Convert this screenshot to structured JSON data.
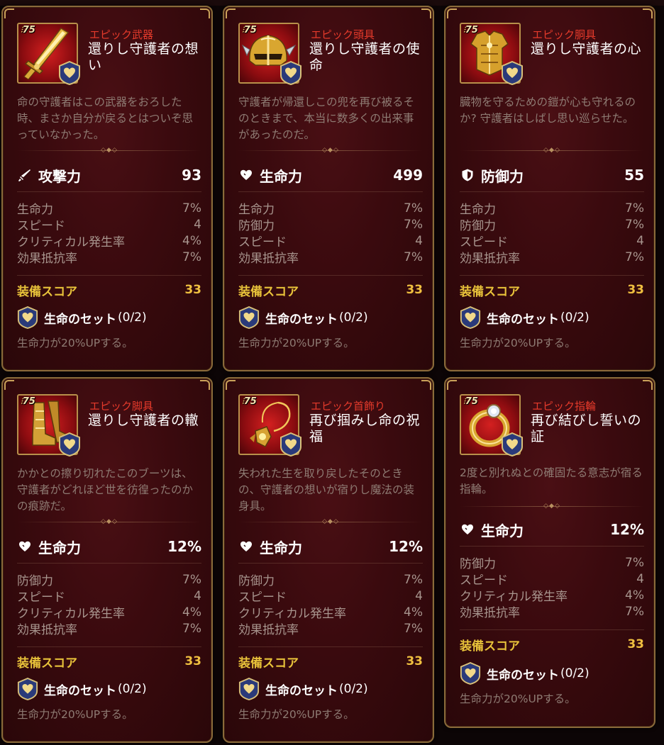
{
  "colors": {
    "category": "#e53a2b",
    "score": "#e8c23a",
    "set_badge_fill": "#2a3a7a",
    "heart": "#e8c872"
  },
  "cards": [
    {
      "level": "75",
      "category": "エピック武器",
      "name": "還りし守護者の想い",
      "description": "命の守護者はこの武器をおろした時、まさか自分が戻るとはついぞ思っていなかった。",
      "main_stat": {
        "icon": "sword-icon",
        "label": "攻撃力",
        "value": "93"
      },
      "substats": [
        {
          "label": "生命力",
          "value": "7%"
        },
        {
          "label": "スピード",
          "value": "4"
        },
        {
          "label": "クリティカル発生率",
          "value": "4%"
        },
        {
          "label": "効果抵抗率",
          "value": "7%"
        }
      ],
      "score_label": "装備スコア",
      "score_value": "33",
      "set_name": "生命のセット",
      "set_count": "(0/2)",
      "set_effect": "生命力が20%UPする。",
      "item_icon": "weapon-icon"
    },
    {
      "level": "75",
      "category": "エピック頭具",
      "name": "還りし守護者の使命",
      "description": "守護者が帰還しこの兜を再び被るそのときまで、本当に数多くの出来事があったのだ。",
      "main_stat": {
        "icon": "heart-icon",
        "label": "生命力",
        "value": "499"
      },
      "substats": [
        {
          "label": "生命力",
          "value": "7%"
        },
        {
          "label": "防御力",
          "value": "7%"
        },
        {
          "label": "スピード",
          "value": "4"
        },
        {
          "label": "効果抵抗率",
          "value": "7%"
        }
      ],
      "score_label": "装備スコア",
      "score_value": "33",
      "set_name": "生命のセット",
      "set_count": "(0/2)",
      "set_effect": "生命力が20%UPする。",
      "item_icon": "helmet-icon"
    },
    {
      "level": "75",
      "category": "エピック胴具",
      "name": "還りし守護者の心",
      "description": "臓物を守るための鎧が心も守れるのか? 守護者はしばし思い巡らせた。",
      "main_stat": {
        "icon": "shield-icon",
        "label": "防御力",
        "value": "55"
      },
      "substats": [
        {
          "label": "生命力",
          "value": "7%"
        },
        {
          "label": "防御力",
          "value": "7%"
        },
        {
          "label": "スピード",
          "value": "4"
        },
        {
          "label": "効果抵抗率",
          "value": "7%"
        }
      ],
      "score_label": "装備スコア",
      "score_value": "33",
      "set_name": "生命のセット",
      "set_count": "(0/2)",
      "set_effect": "生命力が20%UPする。",
      "item_icon": "armor-icon"
    },
    {
      "level": "75",
      "category": "エピック脚具",
      "name": "還りし守護者の轍",
      "description": "かかとの擦り切れたこのブーツは、守護者がどれほど世を彷徨ったのかの痕跡だ。",
      "main_stat": {
        "icon": "heart-icon",
        "label": "生命力",
        "value": "12%"
      },
      "substats": [
        {
          "label": "防御力",
          "value": "7%"
        },
        {
          "label": "スピード",
          "value": "4"
        },
        {
          "label": "クリティカル発生率",
          "value": "4%"
        },
        {
          "label": "効果抵抗率",
          "value": "7%"
        }
      ],
      "score_label": "装備スコア",
      "score_value": "33",
      "set_name": "生命のセット",
      "set_count": "(0/2)",
      "set_effect": "生命力が20%UPする。",
      "item_icon": "boots-icon"
    },
    {
      "level": "75",
      "category": "エピック首飾り",
      "name": "再び掴みし命の祝福",
      "description": "失われた生を取り戻したそのときの、守護者の想いが宿りし魔法の装身具。",
      "main_stat": {
        "icon": "heart-icon",
        "label": "生命力",
        "value": "12%"
      },
      "substats": [
        {
          "label": "防御力",
          "value": "7%"
        },
        {
          "label": "スピード",
          "value": "4"
        },
        {
          "label": "クリティカル発生率",
          "value": "4%"
        },
        {
          "label": "効果抵抗率",
          "value": "7%"
        }
      ],
      "score_label": "装備スコア",
      "score_value": "33",
      "set_name": "生命のセット",
      "set_count": "(0/2)",
      "set_effect": "生命力が20%UPする。",
      "item_icon": "necklace-icon"
    },
    {
      "level": "75",
      "category": "エピック指輪",
      "name": "再び結びし誓いの証",
      "description": "2度と別れぬとの確固たる意志が宿る指輪。",
      "main_stat": {
        "icon": "heart-icon",
        "label": "生命力",
        "value": "12%"
      },
      "substats": [
        {
          "label": "防御力",
          "value": "7%"
        },
        {
          "label": "スピード",
          "value": "4"
        },
        {
          "label": "クリティカル発生率",
          "value": "4%"
        },
        {
          "label": "効果抵抗率",
          "value": "7%"
        }
      ],
      "score_label": "装備スコア",
      "score_value": "33",
      "set_name": "生命のセット",
      "set_count": "(0/2)",
      "set_effect": "生命力が20%UPする。",
      "item_icon": "ring-icon"
    }
  ]
}
